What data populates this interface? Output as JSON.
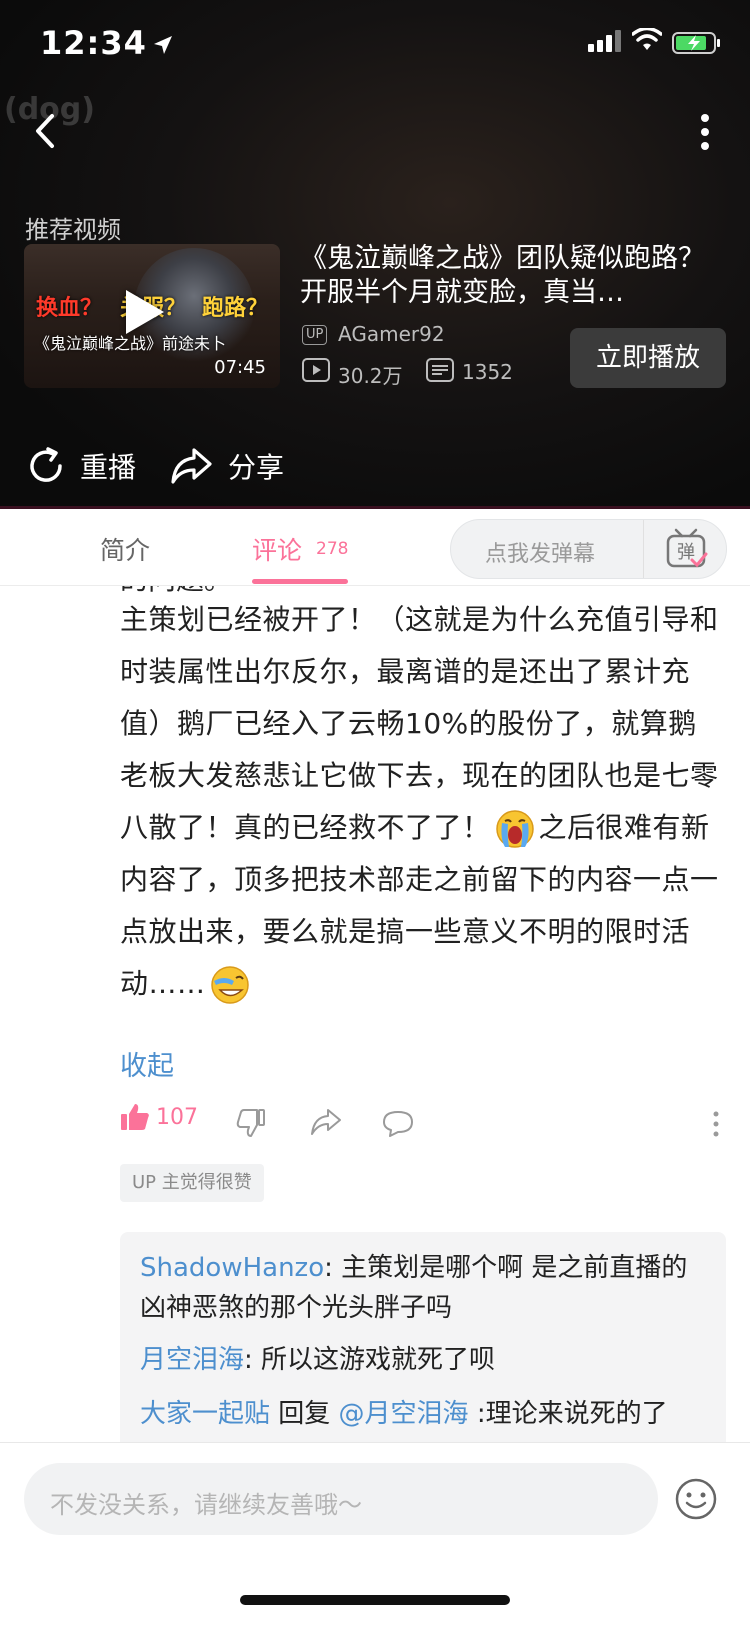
{
  "status_bar": {
    "time": "12:34"
  },
  "video": {
    "watermark": "(dog)",
    "recommend_label": "推荐视频",
    "thumbnail": {
      "text_a": "换血？",
      "text_b": "关服？",
      "text_c": "跑路？",
      "subtitle": "《鬼泣巅峰之战》前途未卜",
      "duration": "07:45"
    },
    "title": "《鬼泣巅峰之战》团队疑似跑路？开服半个月就变脸，真当…",
    "up_badge": "UP",
    "uploader": "AGamer92",
    "play_count": "30.2万",
    "danmaku_count": "1352",
    "play_now_label": "立即播放",
    "replay_label": "重播",
    "share_label": "分享"
  },
  "tabs": {
    "intro": "简介",
    "comments": "评论",
    "comments_count": "278",
    "danmaku_placeholder": "点我发弹幕",
    "danmaku_button": "弹"
  },
  "comment": {
    "cut_line": "的问题。",
    "body_part1": "主策划已经被开了！（这就是为什么充值引导和时装属性出尔反尔，最离谱的是还出了累计充值）鹅厂已经入了云畅10%的股份了，就算鹅老板大发慈悲让它做下去，现在的团队也是七零八散了！真的已经救不了了！",
    "body_part2": "之后很难有新内容了，顶多把技术部走之前留下的内容一点一点放出来，要么就是搞一些意义不明的限时活动……",
    "collapse_label": "收起",
    "likes": "107",
    "up_liked": "UP 主觉得很赞"
  },
  "replies": [
    {
      "user": "ShadowHanzo",
      "sep": ": ",
      "text": "主策划是哪个啊 是之前直播的凶神恶煞的那个光头胖子吗"
    },
    {
      "user": "月空泪海",
      "sep": ": ",
      "text": "所以这游戏就死了呗"
    },
    {
      "user": "大家一起贴",
      "mid": " 回复 ",
      "mention": "@月空泪海",
      "text": " :理论来说死的了"
    }
  ],
  "bottom": {
    "placeholder": "不发没关系，请继续友善哦～"
  },
  "colors": {
    "accent": "#fb7299",
    "link": "#4d8fce"
  }
}
